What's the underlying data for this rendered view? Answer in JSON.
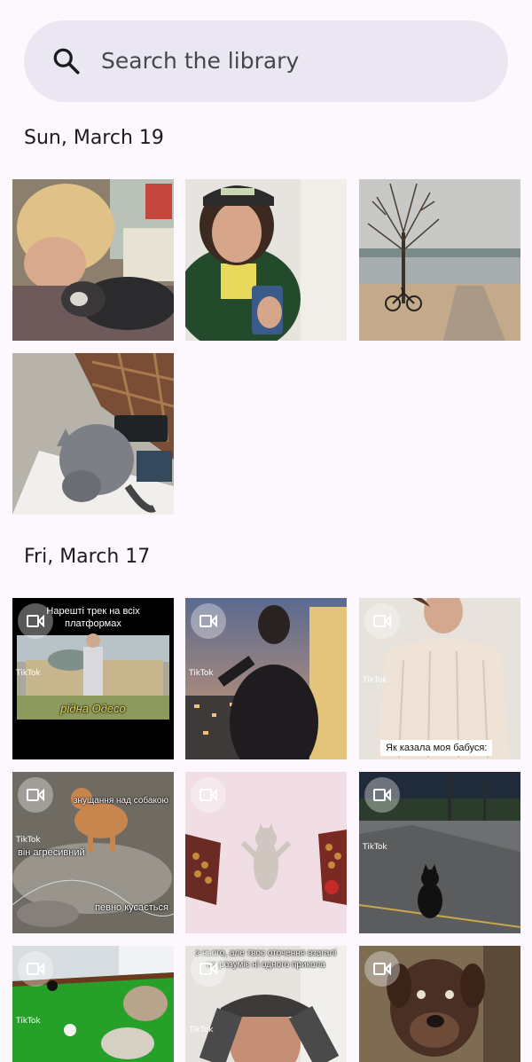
{
  "search": {
    "placeholder": "Search the library",
    "icon": "search-icon"
  },
  "sections": [
    {
      "date": "Sun, March 19",
      "items": [
        {
          "kind": "photo",
          "subject": "person-with-cat"
        },
        {
          "kind": "photo",
          "subject": "selfie-with-helmet"
        },
        {
          "kind": "photo",
          "subject": "tree-by-lake"
        },
        {
          "kind": "photo",
          "subject": "grey-cat-on-desk"
        }
      ]
    },
    {
      "date": "Fri, March 17",
      "items": [
        {
          "kind": "video",
          "top_caption": "Нарешті трек на всіх платформах",
          "bottom_caption": "рідна Одесо",
          "tiktok": "TikTok"
        },
        {
          "kind": "video",
          "tiktok": "TikTok"
        },
        {
          "kind": "video",
          "bottom_caption": "Як казала моя бабуся:",
          "tiktok": "TikTok"
        },
        {
          "kind": "video",
          "top_caption": "знущання над собакою",
          "middle_caption": "він агресивний",
          "bottom_caption": "певно кусається",
          "tiktok": "TikTok"
        },
        {
          "kind": "video",
          "tiktok": ""
        },
        {
          "kind": "video",
          "tiktok": "TikTok"
        },
        {
          "kind": "video",
          "tiktok": "TikTok"
        },
        {
          "kind": "video",
          "top_caption": "з нього, але твоє оточення взагалі не розуміє ні одного прикола",
          "tiktok": "TikTok"
        },
        {
          "kind": "video",
          "tiktok": ""
        }
      ]
    }
  ],
  "colors": {
    "background": "#fdf8fd",
    "search_bg": "#ebe7f2",
    "text": "#1c1b1f"
  }
}
